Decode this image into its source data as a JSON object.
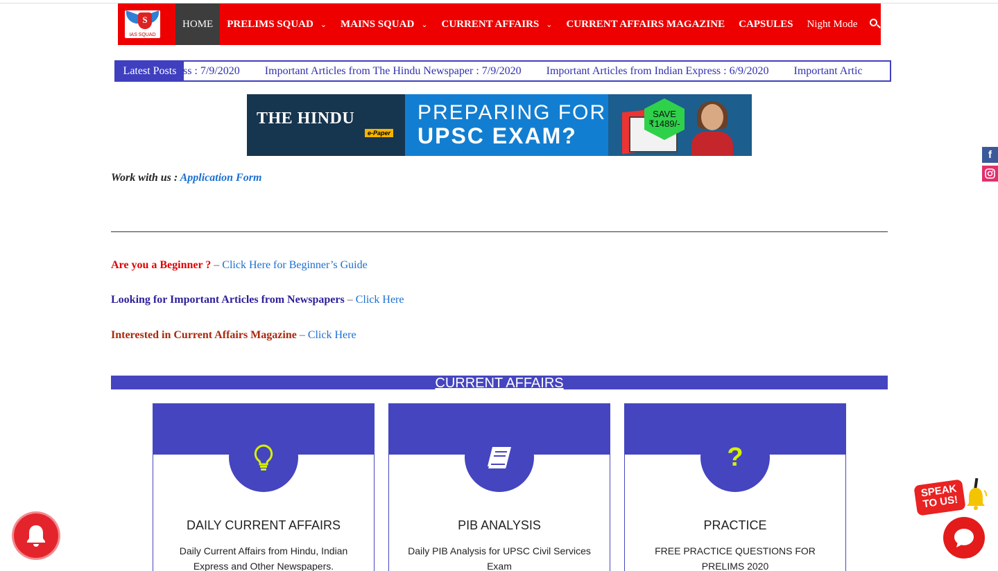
{
  "nav": {
    "logo_text": "IAS SQUAD",
    "items": [
      {
        "label": "HOME",
        "has_chevron": false
      },
      {
        "label": "PRELIMS SQUAD",
        "has_chevron": true
      },
      {
        "label": "MAINS SQUAD",
        "has_chevron": true
      },
      {
        "label": "CURRENT AFFAIRS",
        "has_chevron": true
      },
      {
        "label": "CURRENT AFFAIRS MAGAZINE",
        "has_chevron": false
      },
      {
        "label": "CAPSULES",
        "has_chevron": false
      },
      {
        "label": "Night Mode",
        "has_chevron": false
      }
    ],
    "search_icon": "search-icon",
    "accent": "#ee0000"
  },
  "ticker": {
    "label": "Latest Posts",
    "items": [
      "ss : 7/9/2020",
      "Important Articles from The Hindu Newspaper : 7/9/2020",
      "Important Articles from Indian Express : 6/9/2020",
      "Important Artic"
    ]
  },
  "banner": {
    "brand": "THE HINDU",
    "brand_sub": "e-Paper",
    "line1": "PREPARING FOR",
    "line2": "UPSC EXAM?",
    "save_label": "SAVE",
    "save_amount": "₹1489/-"
  },
  "work": {
    "prefix": "Work with us :",
    "link": "Application Form"
  },
  "links": [
    {
      "question": "Are you a Beginner ?",
      "sep": " – ",
      "link": "Click Here for Beginner’s Guide",
      "color": "#e00000"
    },
    {
      "question": "Looking for Important Articles from Newspapers",
      "sep": " – ",
      "link": "Click Here",
      "color": "#2b1e9a"
    },
    {
      "question": "Interested in Current Affairs Magazine",
      "sep": " – ",
      "link": "Click Here",
      "color": "#a8280c"
    }
  ],
  "section": {
    "title": "CURRENT AFFAIRS",
    "color": "#4545c0"
  },
  "cards": [
    {
      "icon": "lightbulb-icon",
      "title": "DAILY CURRENT AFFAIRS",
      "desc": "Daily Current Affairs from Hindu, Indian Express and Other Newspapers."
    },
    {
      "icon": "book-icon",
      "title": "PIB ANALYSIS",
      "desc": "Daily PIB Analysis for UPSC Civil Services Exam"
    },
    {
      "icon": "question-icon",
      "title": "PRACTICE",
      "desc": "FREE PRACTICE QUESTIONS FOR PRELIMS 2020"
    }
  ],
  "floating": {
    "speak_text": "SPEAK TO US!",
    "icons": [
      "facebook-icon",
      "instagram-icon",
      "notification-bell-icon",
      "chat-icon"
    ]
  }
}
